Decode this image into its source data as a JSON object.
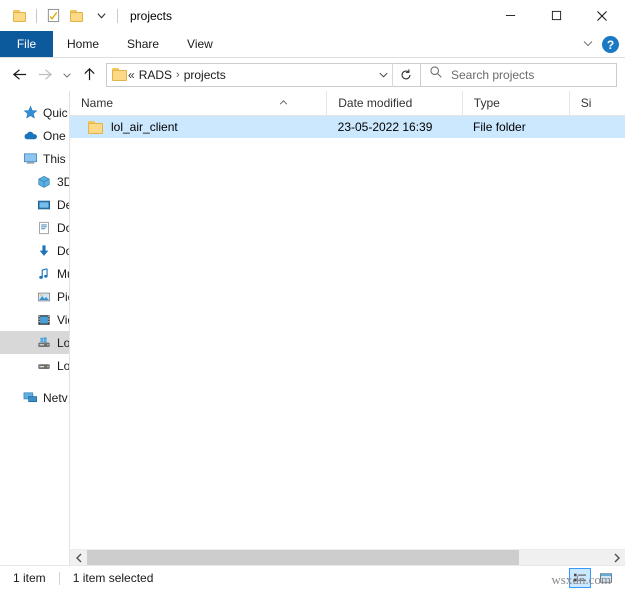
{
  "window": {
    "title": "projects",
    "quick_access": [
      {
        "name": "save-icon",
        "icon": "folder"
      },
      {
        "name": "properties-icon",
        "icon": "properties"
      },
      {
        "name": "new-folder-icon",
        "icon": "folder"
      },
      {
        "name": "customize-chevron-icon",
        "icon": "chevron-down"
      }
    ],
    "controls": {
      "minimize": "—",
      "maximize": "□",
      "close": "✕"
    }
  },
  "ribbon": {
    "file_tab": "File",
    "tabs": [
      "Home",
      "Share",
      "View"
    ],
    "collapse_icon": "chevron-down",
    "help_label": "?"
  },
  "nav": {
    "back_icon": "arrow-left",
    "forward_icon": "arrow-right",
    "recent_icon": "chevron-down",
    "up_icon": "arrow-up",
    "breadcrumb": {
      "overflow": "«",
      "items": [
        "RADS",
        "projects"
      ],
      "separator": "›"
    },
    "address_dropdown_icon": "chevron-down",
    "refresh_icon": "refresh",
    "search_placeholder": "Search projects",
    "search_value": ""
  },
  "sidebar": {
    "items": [
      {
        "label": "Quic",
        "icon": "star-icon",
        "level": 0,
        "selected": false
      },
      {
        "label": "One",
        "icon": "cloud-icon",
        "level": 0,
        "selected": false
      },
      {
        "label": "This",
        "icon": "monitor-icon",
        "level": 0,
        "selected": false
      },
      {
        "label": "3D",
        "icon": "cube-icon",
        "level": 1,
        "selected": false
      },
      {
        "label": "De",
        "icon": "desktop-icon",
        "level": 1,
        "selected": false
      },
      {
        "label": "Do",
        "icon": "document-icon",
        "level": 1,
        "selected": false
      },
      {
        "label": "Do",
        "icon": "download-icon",
        "level": 1,
        "selected": false
      },
      {
        "label": "Mu",
        "icon": "music-icon",
        "level": 1,
        "selected": false
      },
      {
        "label": "Pic",
        "icon": "picture-icon",
        "level": 1,
        "selected": false
      },
      {
        "label": "Vid",
        "icon": "video-icon",
        "level": 1,
        "selected": false
      },
      {
        "label": "Lo",
        "icon": "system-drive-icon",
        "level": 1,
        "selected": true
      },
      {
        "label": "Lo",
        "icon": "drive-icon",
        "level": 1,
        "selected": false
      },
      {
        "label": "Netv",
        "icon": "network-icon",
        "level": 0,
        "selected": false
      }
    ]
  },
  "filelist": {
    "columns": [
      {
        "label": "Name",
        "sorted": "asc"
      },
      {
        "label": "Date modified",
        "sorted": ""
      },
      {
        "label": "Type",
        "sorted": ""
      },
      {
        "label": "Si",
        "sorted": ""
      }
    ],
    "rows": [
      {
        "name": "lol_air_client",
        "date_modified": "23-05-2022 16:39",
        "type": "File folder",
        "size": "",
        "icon": "folder-icon",
        "selected": true
      }
    ]
  },
  "scrollbar": {
    "left_icon": "‹",
    "right_icon": "›"
  },
  "status": {
    "item_count": "1 item",
    "selection": "1 item selected",
    "view_details_icon": "details-view-icon",
    "view_large_icon": "large-icons-view-icon"
  },
  "watermark": "wsxdn.com",
  "colors": {
    "file_tab_blue": "#0c5a9c",
    "selection_blue": "#cce8ff",
    "help_blue": "#1b79c4",
    "folder_yellow": "#fcd986"
  }
}
